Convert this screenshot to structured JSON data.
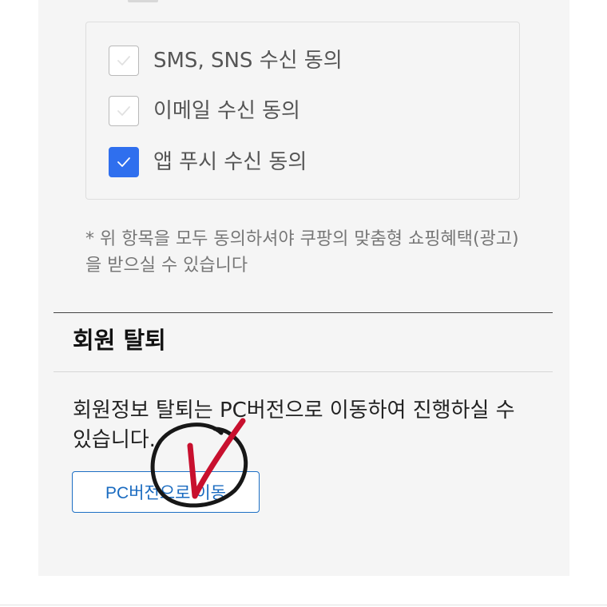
{
  "consent": {
    "items": [
      {
        "label": "SMS, SNS 수신 동의",
        "checked": false
      },
      {
        "label": "이메일 수신 동의",
        "checked": false
      },
      {
        "label": "앱 푸시 수신 동의",
        "checked": true
      }
    ],
    "note": "* 위 항목을 모두 동의하셔야 쿠팡의 맞춤형 쇼핑혜택(광고)을 받으실 수 있습니다"
  },
  "withdrawal": {
    "title": "회원 탈퇴",
    "description": "회원정보 탈퇴는 PC버전으로 이동하여 진행하실 수 있습니다.",
    "button_label": "PC버전으로 이동"
  },
  "colors": {
    "checked_blue": "#2f6fee",
    "link_blue": "#1a6bc0",
    "annotation_red": "#c8102e"
  },
  "icons": {
    "unchecked": "check-icon",
    "checked": "check-icon",
    "annotation": "checkmark-circle-annotation"
  }
}
